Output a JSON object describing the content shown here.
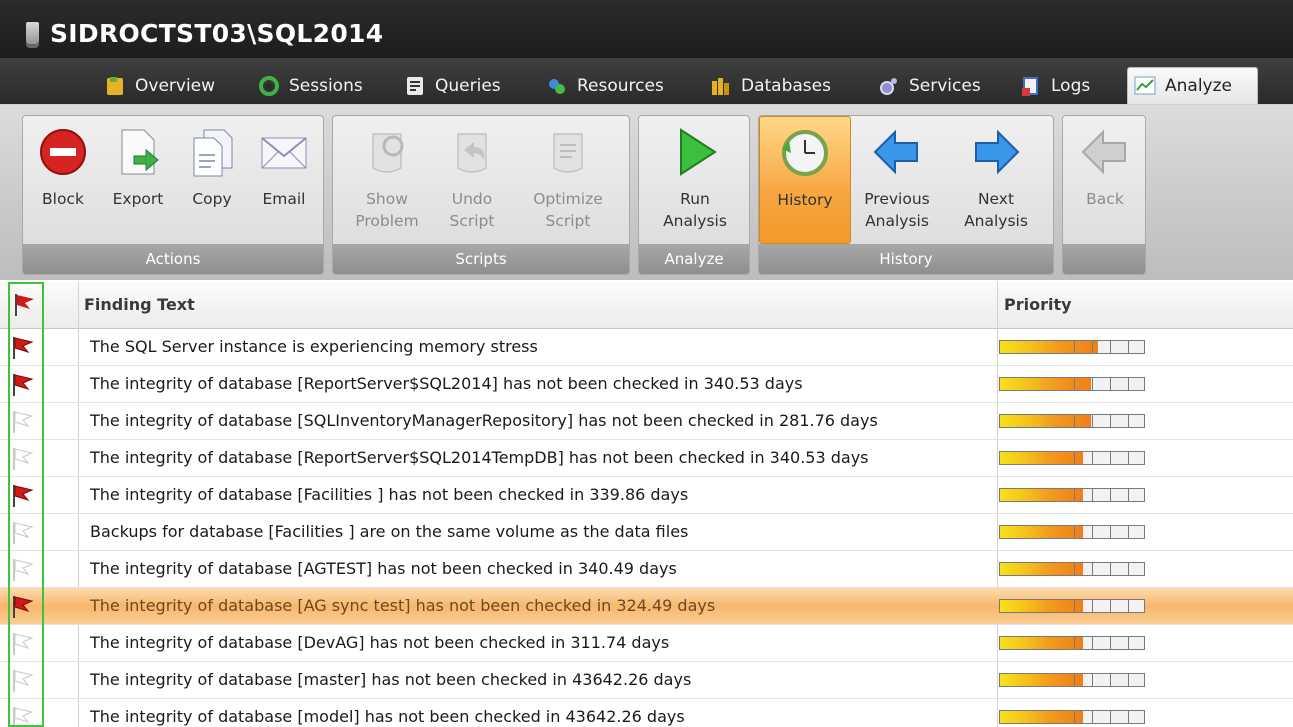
{
  "window": {
    "title": "SIDROCTST03\\SQL2014"
  },
  "tabs": [
    {
      "label": "Overview",
      "icon": "overview-icon",
      "active": false
    },
    {
      "label": "Sessions",
      "icon": "sessions-icon",
      "active": false
    },
    {
      "label": "Queries",
      "icon": "queries-icon",
      "active": false
    },
    {
      "label": "Resources",
      "icon": "resources-icon",
      "active": false
    },
    {
      "label": "Databases",
      "icon": "databases-icon",
      "active": false
    },
    {
      "label": "Services",
      "icon": "services-icon",
      "active": false
    },
    {
      "label": "Logs",
      "icon": "logs-icon",
      "active": false
    },
    {
      "label": "Analyze",
      "icon": "analyze-icon",
      "active": true
    }
  ],
  "ribbon": {
    "groups": {
      "actions": "Actions",
      "scripts": "Scripts",
      "analyze": "Analyze",
      "history": "History"
    },
    "buttons": {
      "block": "Block",
      "export": "Export",
      "copy": "Copy",
      "email": "Email",
      "show_problem_1": "Show",
      "show_problem_2": "Problem",
      "undo_script_1": "Undo",
      "undo_script_2": "Script",
      "optimize_script_1": "Optimize",
      "optimize_script_2": "Script",
      "run_analysis_1": "Run",
      "run_analysis_2": "Analysis",
      "history": "History",
      "previous_analysis_1": "Previous",
      "previous_analysis_2": "Analysis",
      "next_analysis_1": "Next",
      "next_analysis_2": "Analysis",
      "back": "Back"
    }
  },
  "grid": {
    "columns": {
      "finding": "Finding Text",
      "priority": "Priority"
    },
    "rows": [
      {
        "flagged": true,
        "text": "The SQL Server instance is experiencing memory stress",
        "priority": 0.67,
        "selected": false
      },
      {
        "flagged": true,
        "text": "The integrity of database [ReportServer$SQL2014] has not been checked in 340.53 days",
        "priority": 0.62,
        "selected": false
      },
      {
        "flagged": false,
        "text": "The integrity of database [SQLInventoryManagerRepository] has not been checked in 281.76 days",
        "priority": 0.62,
        "selected": false
      },
      {
        "flagged": false,
        "text": "The integrity of database [ReportServer$SQL2014TempDB] has not been checked in 340.53 days",
        "priority": 0.57,
        "selected": false
      },
      {
        "flagged": true,
        "text": "The integrity of database [Facilities ] has not been checked in 339.86 days",
        "priority": 0.57,
        "selected": false
      },
      {
        "flagged": false,
        "text": "Backups for database [Facilities ] are on the same volume as the data files",
        "priority": 0.57,
        "selected": false
      },
      {
        "flagged": false,
        "text": "The integrity of database [AGTEST] has not been checked in 340.49 days",
        "priority": 0.57,
        "selected": false
      },
      {
        "flagged": true,
        "text": "The integrity of database [AG sync test] has not been checked in 324.49 days",
        "priority": 0.57,
        "selected": true
      },
      {
        "flagged": false,
        "text": "The integrity of database [DevAG] has not been checked in 311.74 days",
        "priority": 0.57,
        "selected": false
      },
      {
        "flagged": false,
        "text": "The integrity of database [master] has not been checked in 43642.26 days",
        "priority": 0.57,
        "selected": false
      },
      {
        "flagged": false,
        "text": "The integrity of database [model] has not been checked in 43642.26 days",
        "priority": 0.57,
        "selected": false
      }
    ]
  },
  "colors": {
    "accent": "#f39a2a",
    "flag_red": "#d01818",
    "flag_empty": "#c8c8c8",
    "flag_column_outline": "#3cc43c"
  }
}
